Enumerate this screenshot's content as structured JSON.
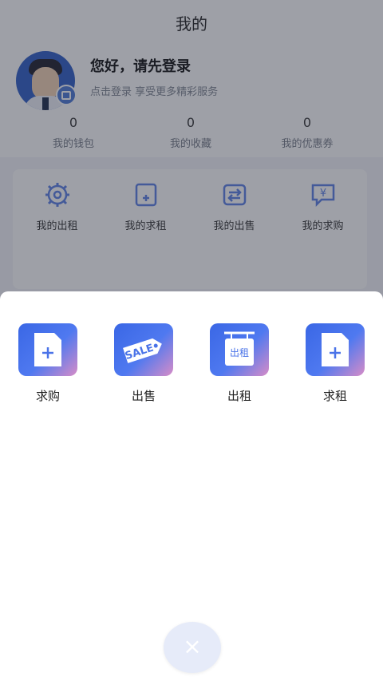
{
  "header": {
    "title": "我的"
  },
  "profile": {
    "greeting": "您好，请先登录",
    "subtitle": "点击登录 享受更多精彩服务",
    "stats": [
      {
        "value": "0",
        "label": "我的钱包"
      },
      {
        "value": "0",
        "label": "我的收藏"
      },
      {
        "value": "0",
        "label": "我的优惠券"
      }
    ]
  },
  "menu": {
    "items": [
      {
        "label": "我的出租",
        "icon": "gear-icon"
      },
      {
        "label": "我的求租",
        "icon": "document-add-icon"
      },
      {
        "label": "我的出售",
        "icon": "swap-icon"
      },
      {
        "label": "我的求购",
        "icon": "yen-chat-icon"
      }
    ]
  },
  "sheet": {
    "actions": [
      {
        "label": "求购",
        "icon": "document-plus-icon"
      },
      {
        "label": "出售",
        "icon": "sale-tag-icon",
        "tag_text": "SALE"
      },
      {
        "label": "出租",
        "icon": "rent-sign-icon",
        "sign_text": "出租"
      },
      {
        "label": "求租",
        "icon": "document-plus-icon"
      }
    ],
    "close_symbol": "×"
  },
  "colors": {
    "accent": "#3F6EE8",
    "overlay": "#2A2F3F"
  }
}
